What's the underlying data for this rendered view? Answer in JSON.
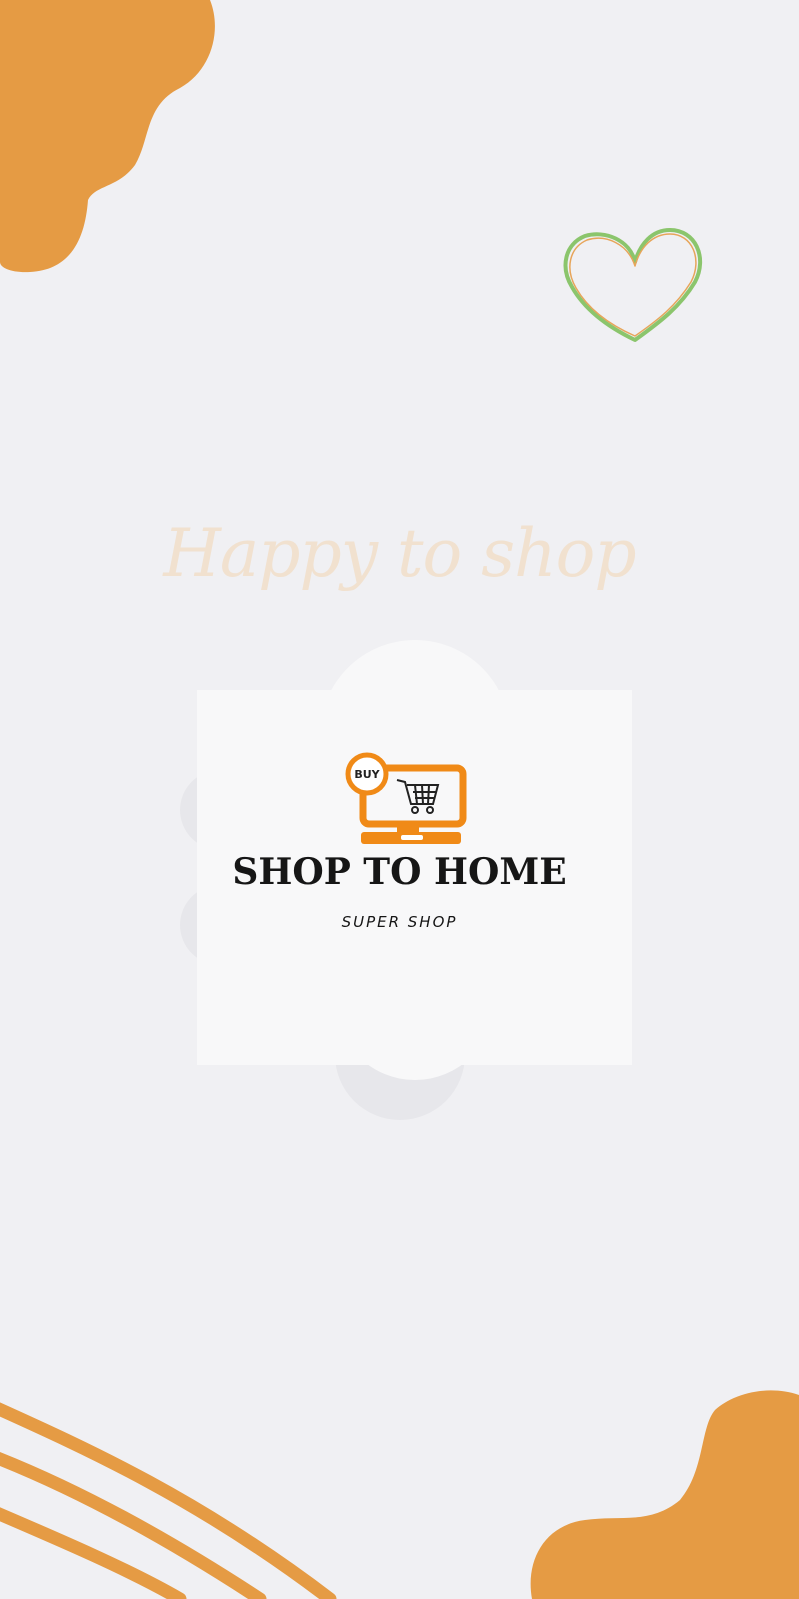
{
  "splash": {
    "tagline": "Happy to shop",
    "brand": {
      "name": "SHOP TO HOME",
      "subtitle": "SUPER SHOP",
      "badge_text": "BUY"
    },
    "icons": [
      "heart-icon",
      "shopping-cart-icon",
      "monitor-icon"
    ],
    "colors": {
      "background": "#f0f0f3",
      "accent_orange": "#e59b44",
      "logo_orange": "#f08a17",
      "heart_green": "#8bc56c",
      "tagline": "#f1e1cf",
      "card": "#f8f8f9"
    }
  }
}
